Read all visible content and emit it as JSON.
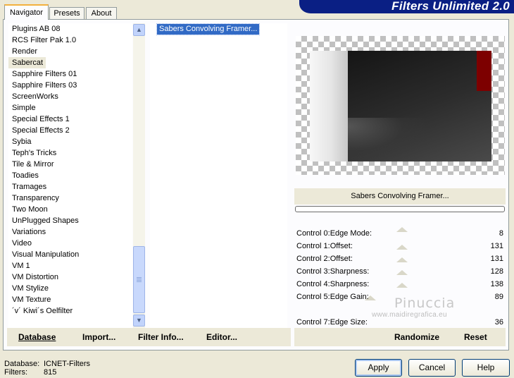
{
  "title": "Filters Unlimited 2.0",
  "tabs": [
    {
      "label": "Navigator",
      "active": true
    },
    {
      "label": "Presets",
      "active": false
    },
    {
      "label": "About",
      "active": false
    }
  ],
  "categories": [
    "Plugins AB 08",
    "RCS Filter Pak 1.0",
    "Render",
    "Sabercat",
    "Sapphire Filters 01",
    "Sapphire Filters 03",
    "ScreenWorks",
    "Simple",
    "Special Effects 1",
    "Special Effects 2",
    "Sybia",
    "Teph's Tricks",
    "Tile & Mirror",
    "Toadies",
    "Tramages",
    "Transparency",
    "Two Moon",
    "UnPlugged Shapes",
    "Variations",
    "Video",
    "Visual Manipulation",
    "VM 1",
    "VM Distortion",
    "VM Stylize",
    "VM Texture",
    "´v´ Kiwi´s Oelfilter"
  ],
  "selected_category": "Sabercat",
  "filters": [
    "Sabers Convolving Framer..."
  ],
  "selected_filter_name": "Sabers Convolving Framer...",
  "controls": [
    {
      "label": "Control 0:Edge Mode:",
      "value": "8"
    },
    {
      "label": "Control 1:Offset:",
      "value": "131"
    },
    {
      "label": "Control 2:Offset:",
      "value": "131"
    },
    {
      "label": "Control 3:Sharpness:",
      "value": "128"
    },
    {
      "label": "Control 4:Sharpness:",
      "value": "138"
    },
    {
      "label": "Control 5:Edge Gain:",
      "value": "89"
    },
    {
      "label": "Control 7:Edge Size:",
      "value": "36"
    }
  ],
  "left_buttons": {
    "database": "Database",
    "import": "Import...",
    "filter_info": "Filter Info...",
    "editor": "Editor..."
  },
  "right_buttons": {
    "randomize": "Randomize",
    "reset": "Reset"
  },
  "watermark": {
    "name": "Pinuccia",
    "site": "www.maidiregrafica.eu"
  },
  "status": {
    "database_label": "Database:",
    "database_value": "ICNET-Filters",
    "filters_label": "Filters:",
    "filters_value": "815"
  },
  "dialog_buttons": {
    "apply": "Apply",
    "cancel": "Cancel",
    "help": "Help"
  },
  "colors": {
    "selection": "#316ac5",
    "banner": "#0a1f84",
    "tab_accent": "#f3b13e"
  }
}
